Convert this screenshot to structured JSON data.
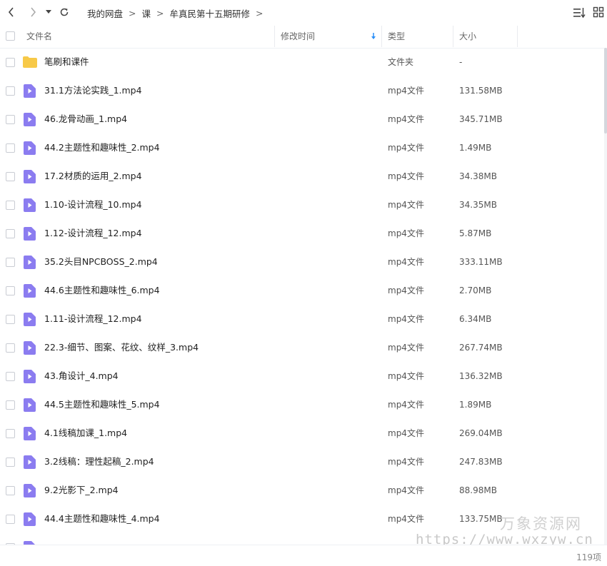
{
  "toolbar": {
    "back_icon": "chevron-left-icon",
    "forward_icon": "chevron-right-icon",
    "history_icon": "caret-down-icon",
    "refresh_icon": "refresh-icon",
    "sort_icon": "sort-list-icon",
    "grid_icon": "grid-view-icon"
  },
  "breadcrumb": {
    "items": [
      "我的网盘",
      "课",
      "牟真民第十五期研修"
    ],
    "separator": ">"
  },
  "columns": {
    "name": "文件名",
    "modified": "修改时间",
    "type": "类型",
    "size": "大小"
  },
  "files": [
    {
      "name": "笔刷和课件",
      "type": "文件夹",
      "size": "-",
      "icon": "folder-icon"
    },
    {
      "name": "31.1方法论实践_1.mp4",
      "type": "mp4文件",
      "size": "131.58MB",
      "icon": "video-file-icon"
    },
    {
      "name": "46.龙骨动画_1.mp4",
      "type": "mp4文件",
      "size": "345.71MB",
      "icon": "video-file-icon"
    },
    {
      "name": "44.2主题性和趣味性_2.mp4",
      "type": "mp4文件",
      "size": "1.49MB",
      "icon": "video-file-icon"
    },
    {
      "name": "17.2材质的运用_2.mp4",
      "type": "mp4文件",
      "size": "34.38MB",
      "icon": "video-file-icon"
    },
    {
      "name": "1.10-设计流程_10.mp4",
      "type": "mp4文件",
      "size": "34.35MB",
      "icon": "video-file-icon"
    },
    {
      "name": "1.12-设计流程_12.mp4",
      "type": "mp4文件",
      "size": "5.87MB",
      "icon": "video-file-icon"
    },
    {
      "name": "35.2头目NPCBOSS_2.mp4",
      "type": "mp4文件",
      "size": "333.11MB",
      "icon": "video-file-icon"
    },
    {
      "name": "44.6主题性和趣味性_6.mp4",
      "type": "mp4文件",
      "size": "2.70MB",
      "icon": "video-file-icon"
    },
    {
      "name": "1.11-设计流程_12.mp4",
      "type": "mp4文件",
      "size": "6.34MB",
      "icon": "video-file-icon"
    },
    {
      "name": "22.3-细节、图案、花纹、纹样_3.mp4",
      "type": "mp4文件",
      "size": "267.74MB",
      "icon": "video-file-icon"
    },
    {
      "name": "43.角设计_4.mp4",
      "type": "mp4文件",
      "size": "136.32MB",
      "icon": "video-file-icon"
    },
    {
      "name": "44.5主题性和趣味性_5.mp4",
      "type": "mp4文件",
      "size": "1.89MB",
      "icon": "video-file-icon"
    },
    {
      "name": "4.1线稿加课_1.mp4",
      "type": "mp4文件",
      "size": "269.04MB",
      "icon": "video-file-icon"
    },
    {
      "name": "3.2线稿：理性起稿_2.mp4",
      "type": "mp4文件",
      "size": "247.83MB",
      "icon": "video-file-icon"
    },
    {
      "name": "9.2光影下_2.mp4",
      "type": "mp4文件",
      "size": "88.98MB",
      "icon": "video-file-icon"
    },
    {
      "name": "44.4主题性和趣味性_4.mp4",
      "type": "mp4文件",
      "size": "133.75MB",
      "icon": "video-file-icon"
    },
    {
      "name": "",
      "type": "",
      "size": "",
      "icon": "video-file-icon"
    }
  ],
  "status": {
    "count": "119项"
  },
  "watermark": {
    "line1": "万象资源网",
    "line2": "https://www.wxzyw.cn"
  },
  "colors": {
    "folder": "#f7c948",
    "video_icon": "#8b7cf0",
    "sort_arrow": "#2a8ff7"
  }
}
